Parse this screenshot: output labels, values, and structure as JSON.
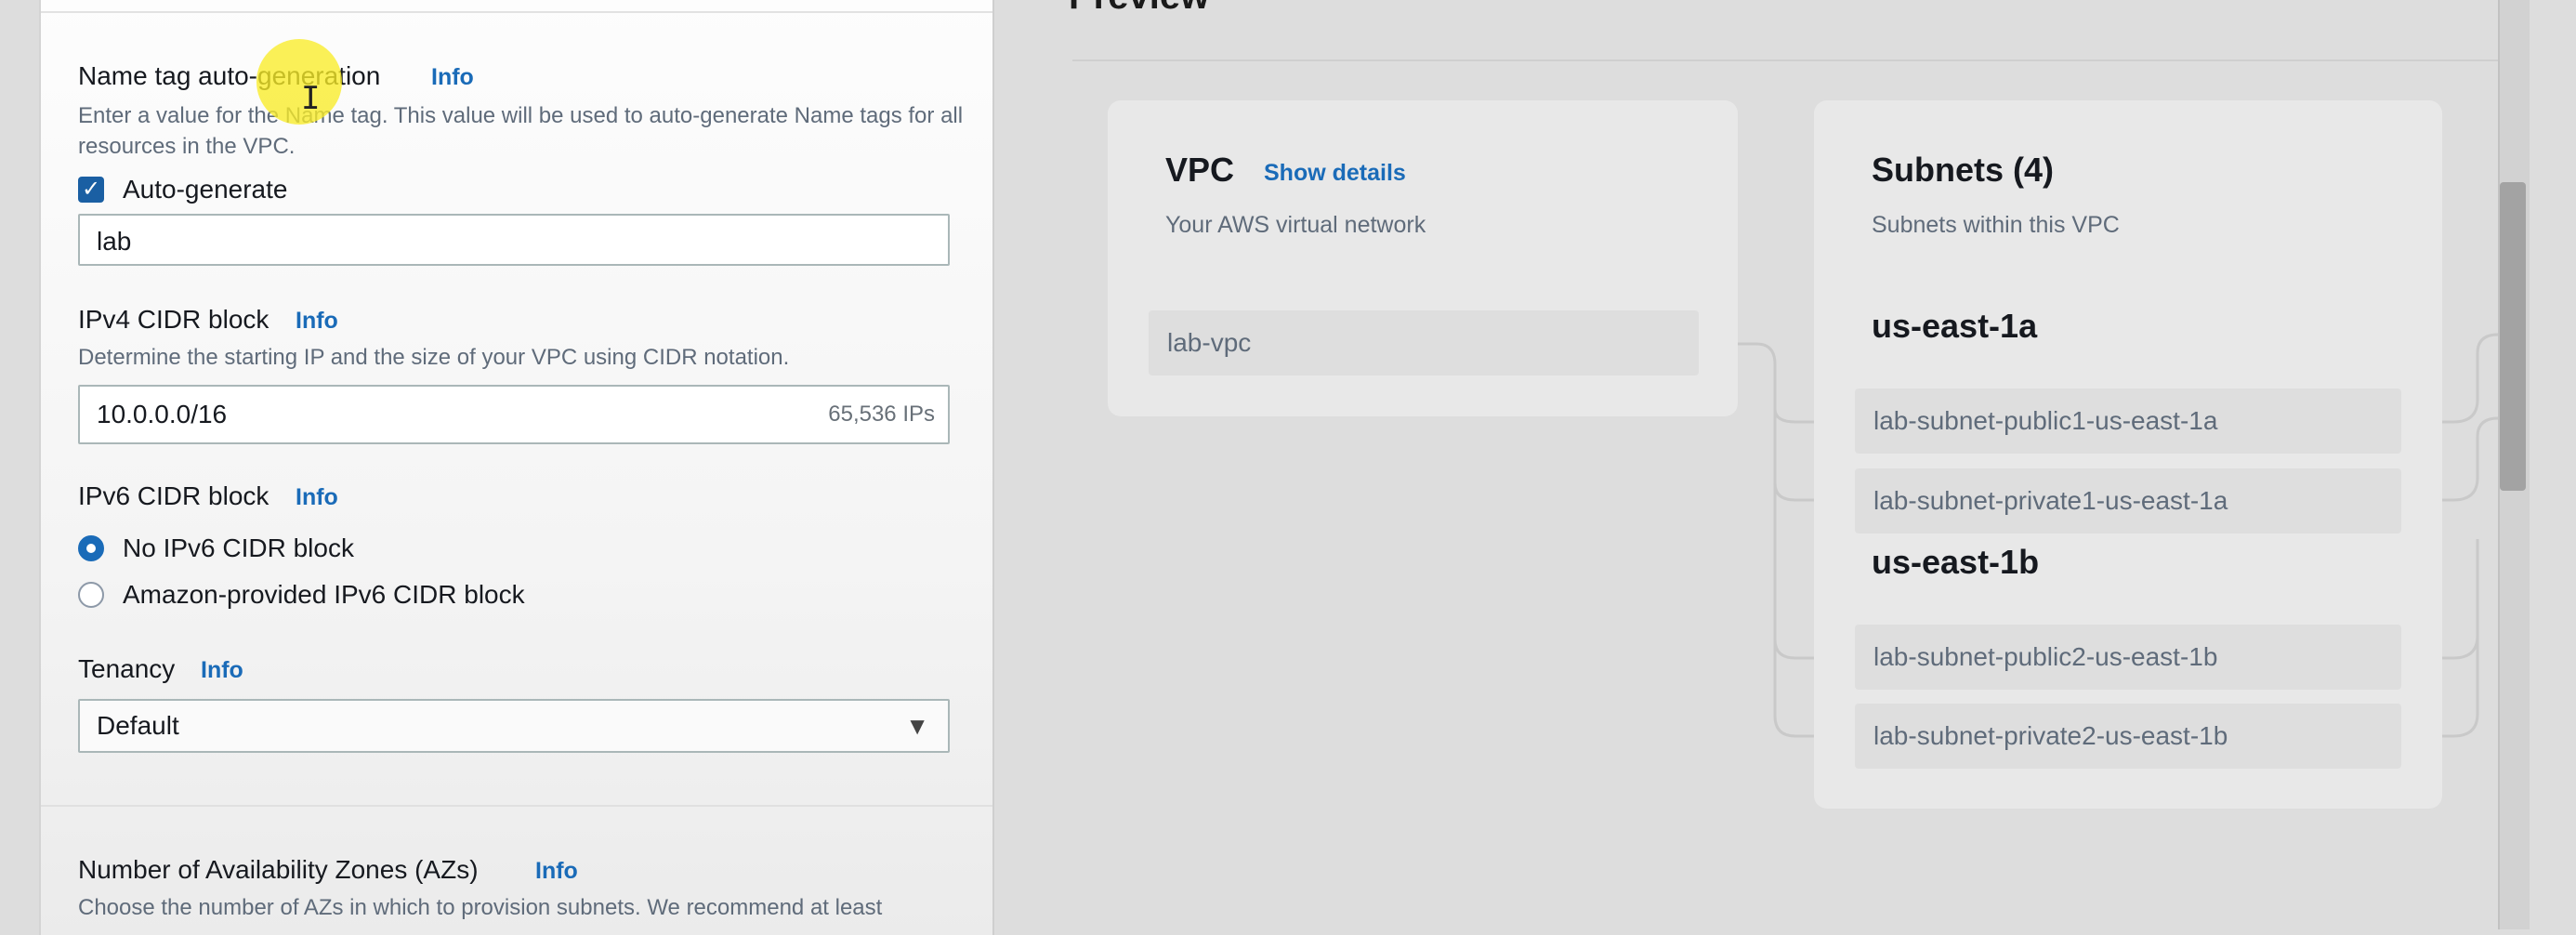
{
  "settings": {
    "name_tag": {
      "label": "Name tag auto-generation",
      "info": "Info",
      "description": "Enter a value for the Name tag. This value will be used to auto-generate Name tags for all resources in the VPC.",
      "checkbox_label": "Auto-generate",
      "checked": true,
      "value": "lab"
    },
    "ipv4": {
      "label": "IPv4 CIDR block",
      "info": "Info",
      "description": "Determine the starting IP and the size of your VPC using CIDR notation.",
      "value": "10.0.0.0/16",
      "hint": "65,536 IPs"
    },
    "ipv6": {
      "label": "IPv6 CIDR block",
      "info": "Info",
      "options": [
        "No IPv6 CIDR block",
        "Amazon-provided IPv6 CIDR block"
      ],
      "selected": "No IPv6 CIDR block"
    },
    "tenancy": {
      "label": "Tenancy",
      "info": "Info",
      "selected": "Default"
    },
    "azs": {
      "label": "Number of Availability Zones (AZs)",
      "info": "Info",
      "description": "Choose the number of AZs in which to provision subnets. We recommend at least"
    }
  },
  "preview": {
    "title": "Preview",
    "vpc": {
      "title": "VPC",
      "details_link": "Show details",
      "subtitle": "Your AWS virtual network",
      "node": "lab-vpc"
    },
    "subnets": {
      "title": "Subnets (4)",
      "subtitle": "Subnets within this VPC",
      "zones": [
        {
          "name": "us-east-1a",
          "subnets": [
            "lab-subnet-public1-us-east-1a",
            "lab-subnet-private1-us-east-1a"
          ]
        },
        {
          "name": "us-east-1b",
          "subnets": [
            "lab-subnet-public2-us-east-1b",
            "lab-subnet-private2-us-east-1b"
          ]
        }
      ]
    }
  },
  "colors": {
    "accent": "#1a6bb8",
    "checkbox": "#1a5fa3",
    "cursor_highlight": "#f8ec28"
  }
}
